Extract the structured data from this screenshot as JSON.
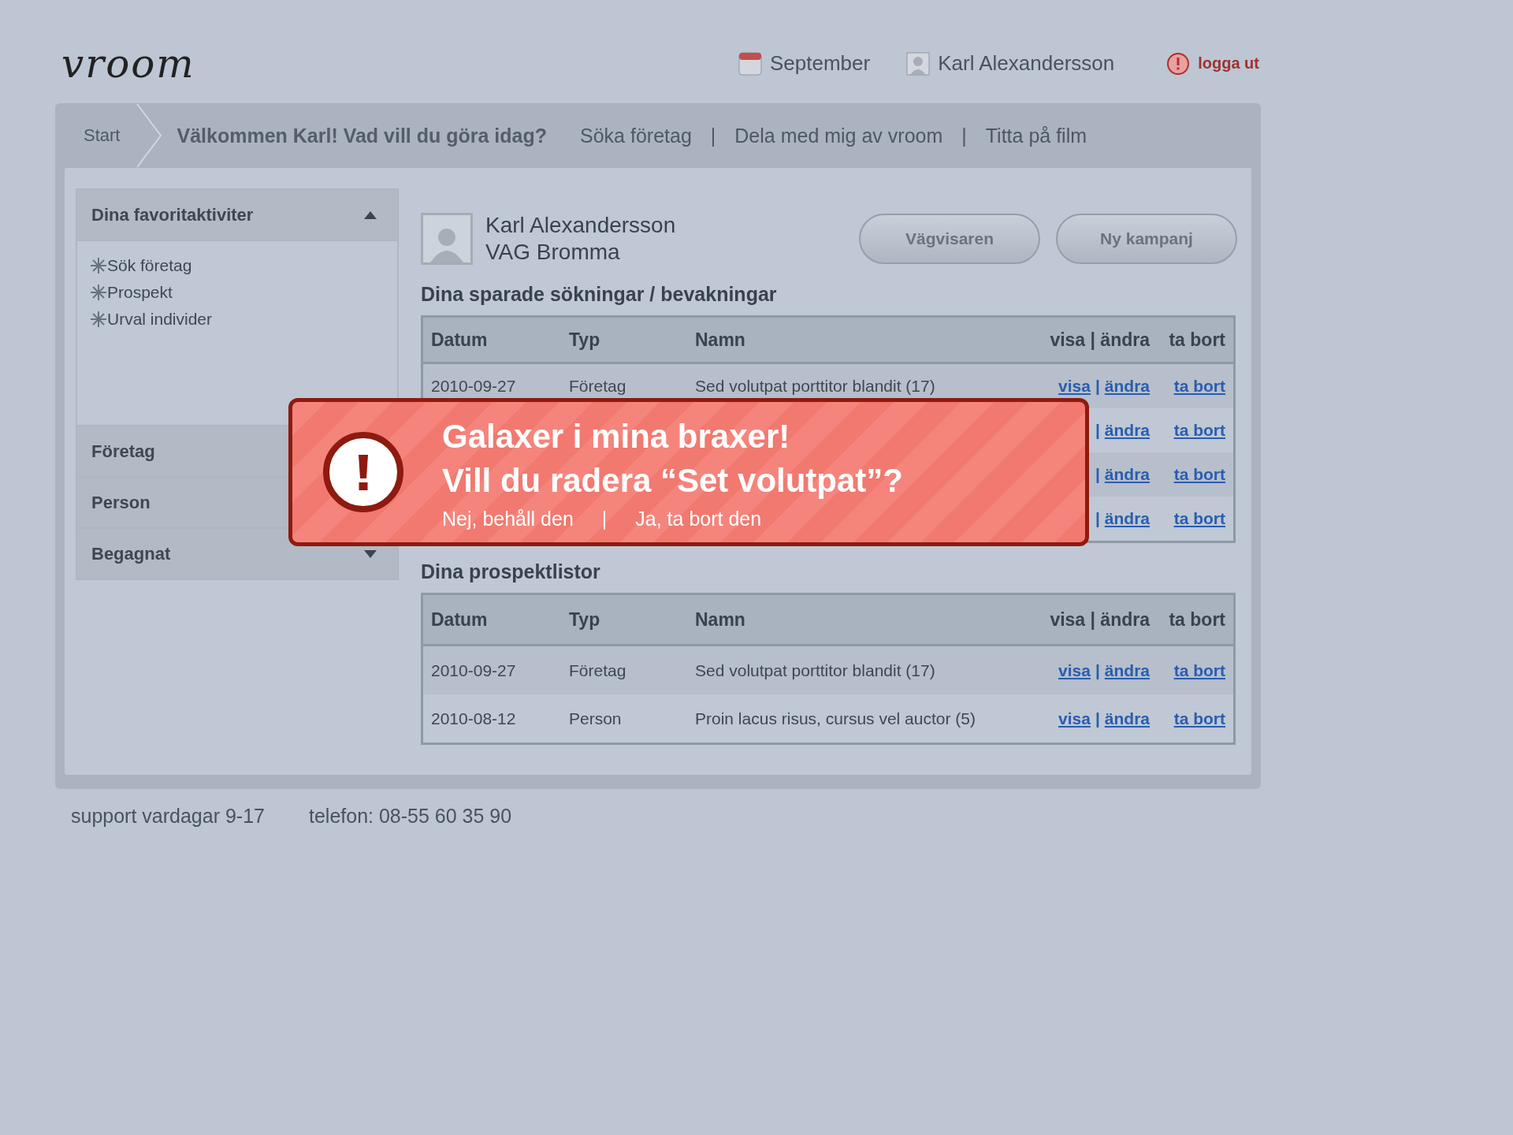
{
  "header": {
    "logo": "vroom",
    "month": "September",
    "user": "Karl Alexandersson",
    "logout": "logga ut"
  },
  "nav": {
    "start": "Start",
    "welcome": "Välkommen Karl! Vad vill du göra idag?",
    "links": [
      "Söka företag",
      "Dela med mig av vroom",
      "Titta på film"
    ],
    "separator": "|"
  },
  "sidebar": {
    "sections": [
      {
        "title": "Dina favoritaktiviter",
        "expanded": true,
        "items": [
          "Sök företag",
          "Prospekt",
          "Urval individer"
        ]
      },
      {
        "title": "Företag",
        "expanded": false
      },
      {
        "title": "Person",
        "expanded": false
      },
      {
        "title": "Begagnat",
        "expanded": false,
        "caret": true
      }
    ]
  },
  "profile": {
    "name": "Karl Alexandersson",
    "org": "VAG Bromma"
  },
  "buttons": [
    "Vägvisaren",
    "Ny kampanj"
  ],
  "tables": [
    {
      "title": "Dina sparade sökningar / bevakningar",
      "columns": [
        "Datum",
        "Typ",
        "Namn",
        "visa | ändra",
        "ta bort"
      ],
      "rows": [
        {
          "date": "2010-09-27",
          "type": "Företag",
          "name": "Sed volutpat porttitor blandit (17)",
          "visa": "visa",
          "sep": "|",
          "andra": "ändra",
          "remove": "ta bort"
        },
        {
          "sep": "|",
          "andra": "ändra",
          "remove": "ta bort"
        },
        {
          "sep": "|",
          "andra": "ändra",
          "remove": "ta bort"
        },
        {
          "sep": "|",
          "andra": "ändra",
          "remove": "ta bort"
        }
      ]
    },
    {
      "title": "Dina prospektlistor",
      "columns": [
        "Datum",
        "Typ",
        "Namn",
        "visa | ändra",
        "ta bort"
      ],
      "rows": [
        {
          "date": "2010-09-27",
          "type": "Företag",
          "name": "Sed volutpat porttitor blandit (17)",
          "visa": "visa",
          "sep": "|",
          "andra": "ändra",
          "remove": "ta bort"
        },
        {
          "date": "2010-08-12",
          "type": "Person",
          "name": "Proin lacus risus, cursus vel auctor (5)",
          "visa": "visa",
          "sep": "|",
          "andra": "ändra",
          "remove": "ta bort"
        }
      ]
    }
  ],
  "alert": {
    "title": "Galaxer i mina braxer!",
    "question": "Vill du radera “Set volutpat”?",
    "cancel": "Nej, behåll den",
    "separator": "|",
    "confirm": "Ja, ta bort den"
  },
  "footer": {
    "support": "support vardagar 9-17",
    "phone": "telefon: 08-55 60 35 90"
  }
}
